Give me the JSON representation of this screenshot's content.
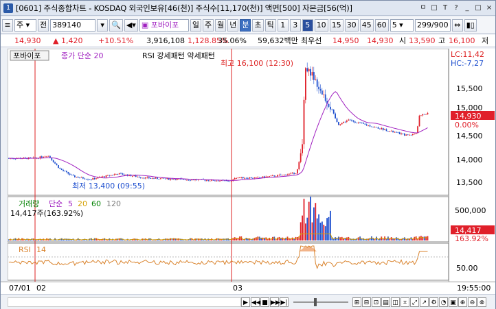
{
  "window": {
    "title": "[0601] 주식종합차트 - KOSDAQ 외국인보유[46(천)] 주식수[11,170(천)] 액면[500] 자본금[56(억)]",
    "icon_label": "1",
    "buttons": [
      "ㅁ",
      "□",
      "T",
      "?",
      "_",
      "□",
      "×"
    ]
  },
  "toolbar": {
    "period_select": "주",
    "mode_label": "전",
    "code": "389140",
    "indicator_tab": "포바이포",
    "periods": [
      "일",
      "주",
      "월",
      "년",
      "분",
      "초",
      "틱"
    ],
    "active_period": "분",
    "intervals": [
      "1",
      "3",
      "5",
      "10",
      "15",
      "30",
      "45",
      "60"
    ],
    "active_interval": "5",
    "interval_value": "5",
    "count": "299/900"
  },
  "quote": {
    "price": "14,930",
    "change": "▲  1,420",
    "change_pct": "+10.51%",
    "volume": "3,916,108",
    "volume_pct": "1,128.85%",
    "turnover": "35.06%",
    "amount": "59,632백만",
    "best_ask_label": "최우선",
    "best_ask": "14,950",
    "best_bid": "14,930",
    "open_label": "시",
    "open": "13,590",
    "high_label": "고",
    "high": "16,100",
    "low_label": "저"
  },
  "price_panel": {
    "tab": "포바이포",
    "ma_label": "종가 단순 20",
    "rsi_pattern_label": "RSI 강세패턴  약세패턴",
    "lc_label": "LC:11,42",
    "hc_label": "HC:-7,27",
    "high_note": "최고 16,100 (12:30)",
    "low_note": "최저 13,400 (09:55)",
    "y_ticks": [
      "15,500",
      "15,000",
      "14,500",
      "14,000",
      "13,500"
    ],
    "last_price_box": "14,930",
    "last_pct": "0.00%",
    "colors": {
      "up": "#e0202a",
      "down": "#1e4fcf",
      "ma": "#a020c0"
    }
  },
  "volume_panel": {
    "title": "거래량",
    "ma_prefix": "단순",
    "ma_periods": [
      "5",
      "20",
      "60",
      "120"
    ],
    "ma_colors": [
      "#a020c0",
      "#d4a000",
      "#008000",
      "#7a7a7a"
    ],
    "current": "14,417주(163.92%)",
    "y_tick": "500,000",
    "last_box": "14,417",
    "last_pct": "163.92%"
  },
  "rsi_panel": {
    "label": "RSI",
    "period": "14",
    "y_tick": "50.00"
  },
  "x_axis": {
    "labels": [
      "07/01",
      "02",
      "03"
    ],
    "time": "19:55:00"
  }
}
